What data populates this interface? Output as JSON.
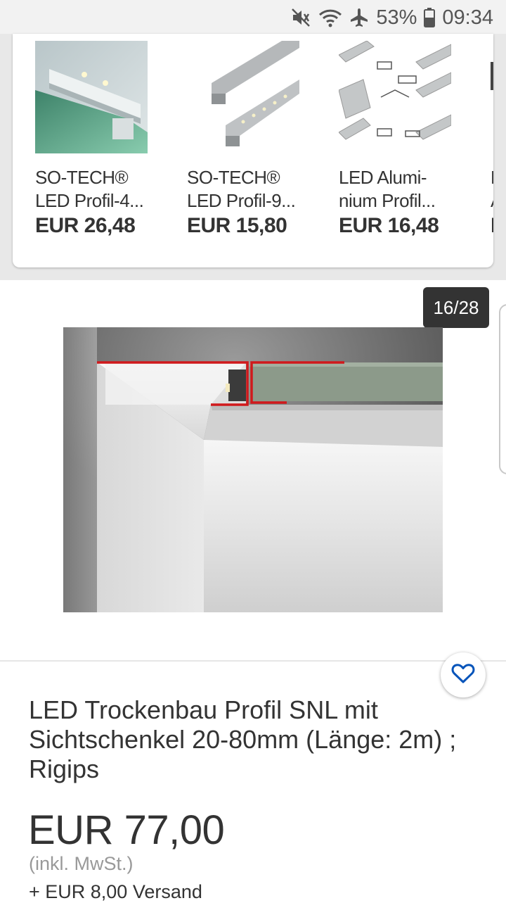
{
  "status_bar": {
    "battery_percent": "53%",
    "time": "09:34",
    "icons": [
      "mute-icon",
      "wifi-icon",
      "airplane-mode-icon",
      "battery-icon"
    ]
  },
  "recommendations": [
    {
      "title": "SO-TECH®\nLED Profil-4...",
      "price": "EUR 26,48"
    },
    {
      "title": "SO-TECH®\nLED Profil-9...",
      "price": "EUR 15,80"
    },
    {
      "title": "LED Alumi-\nnium Profil...",
      "price": "EUR 16,48"
    },
    {
      "title": "L\nA",
      "price": "E"
    }
  ],
  "gallery": {
    "counter": "16/28"
  },
  "product": {
    "title": "LED Trockenbau Profil SNL mit Sichtschenkel 20-80mm (Länge: 2m) ; Rigips",
    "price": "EUR 77,00",
    "tax_note": "(inkl. MwSt.)",
    "shipping": "+ EUR 8,00 Versand"
  },
  "colors": {
    "accent": "#0654ba",
    "profile_red": "#d0191c"
  }
}
